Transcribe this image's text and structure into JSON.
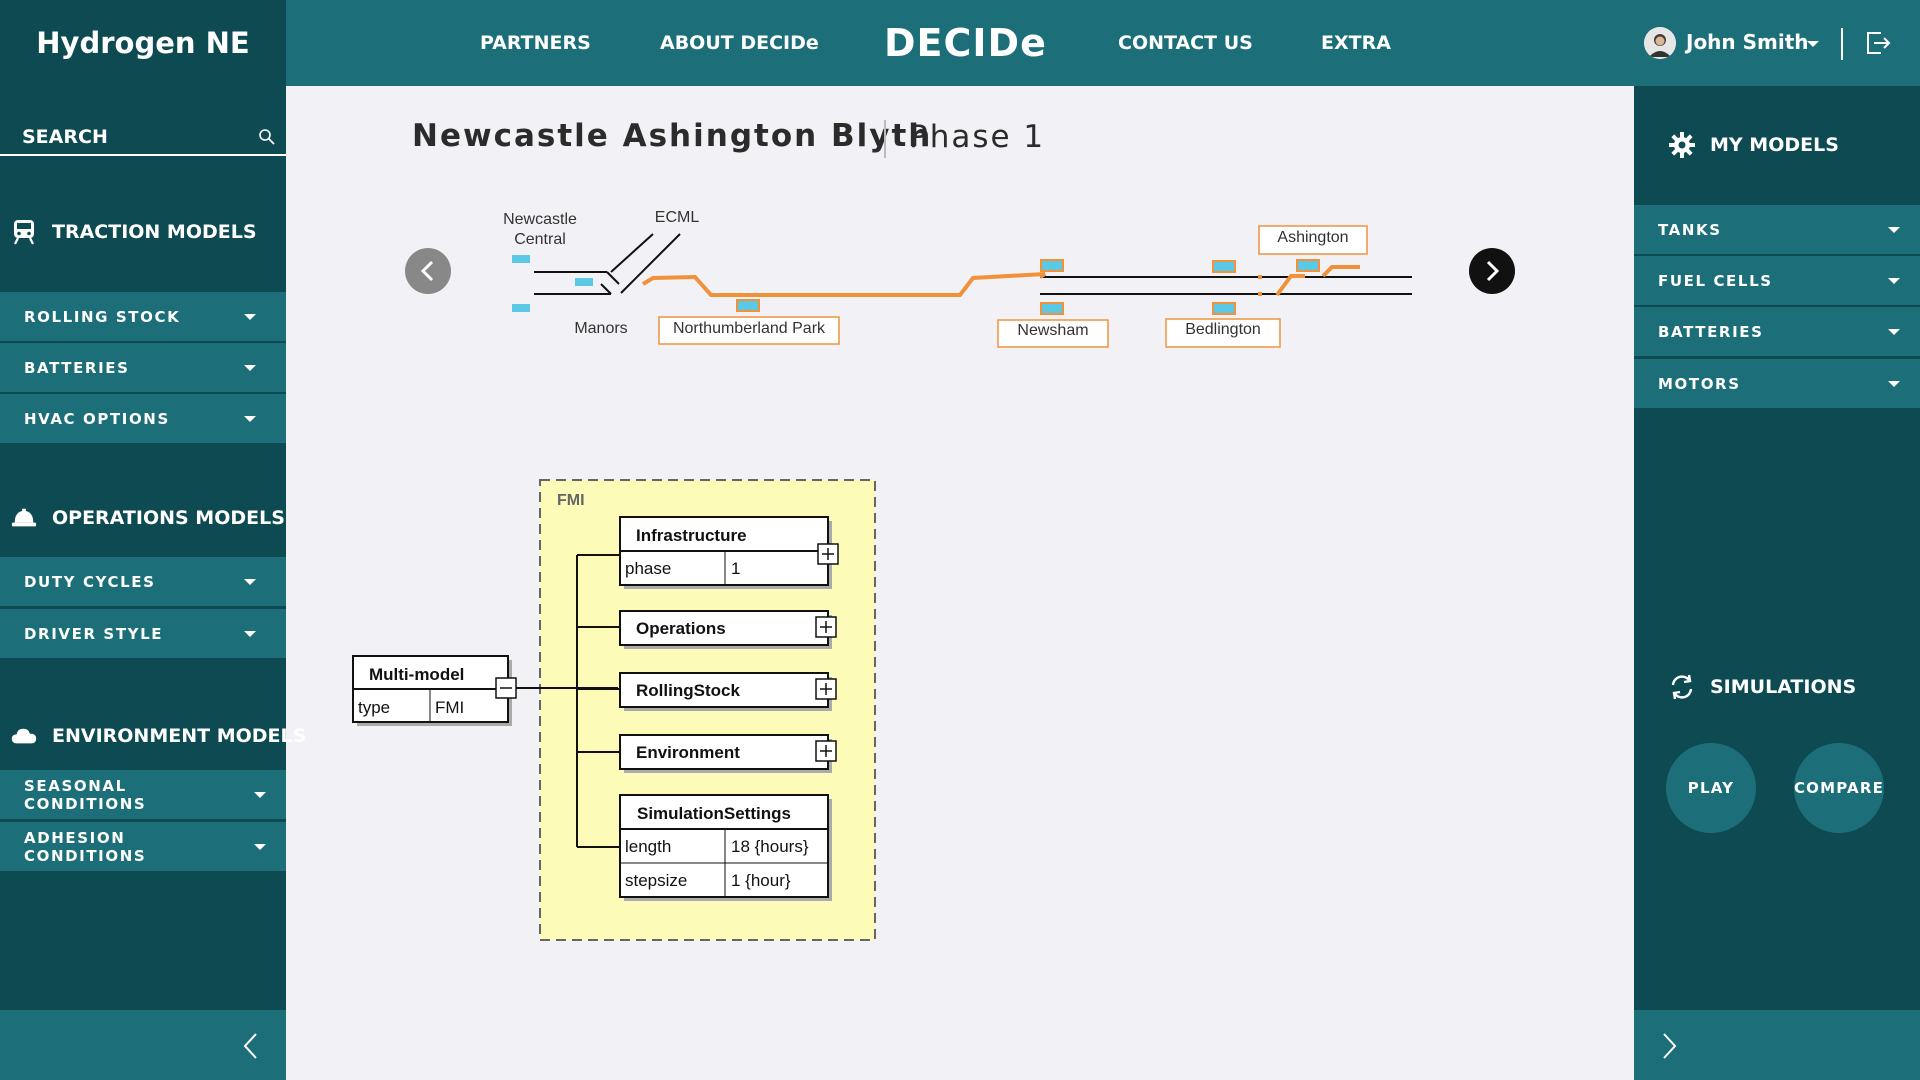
{
  "brand": "Hydrogen NE",
  "search": {
    "placeholder": "SEARCH"
  },
  "left_sidebar": {
    "sections": [
      {
        "title": "TRACTION MODELS",
        "icon": "train-icon",
        "items": [
          {
            "label": "ROLLING STOCK"
          },
          {
            "label": "BATTERIES"
          },
          {
            "label": "HVAC OPTIONS"
          }
        ]
      },
      {
        "title": "OPERATIONS MODELS",
        "icon": "hard-hat-icon",
        "items": [
          {
            "label": "DUTY CYCLES"
          },
          {
            "label": "DRIVER STYLE"
          }
        ]
      },
      {
        "title": "ENVIRONMENT MODELS",
        "icon": "cloud-icon",
        "items": [
          {
            "label": "SEASONAL CONDITIONS"
          },
          {
            "label": "ADHESION CONDITIONS"
          }
        ]
      }
    ]
  },
  "topnav": {
    "links": [
      {
        "label": "PARTNERS"
      },
      {
        "label": "ABOUT DECIDe"
      },
      {
        "label": "CONTACT US"
      },
      {
        "label": "EXTRA"
      }
    ],
    "logo": "DECIDe"
  },
  "user": {
    "name": "John Smith"
  },
  "right_sidebar": {
    "my_models": {
      "title": "MY MODELS",
      "items": [
        {
          "label": "TANKS"
        },
        {
          "label": "FUEL CELLS"
        },
        {
          "label": "BATTERIES"
        },
        {
          "label": "MOTORS"
        }
      ]
    },
    "simulations": {
      "title": "SIMULATIONS",
      "play": "PLAY",
      "compare": "COMPARE"
    }
  },
  "main": {
    "title": "Newcastle Ashington Blyth",
    "subtitle": "Phase 1",
    "route_map": {
      "labels": {
        "newcastle_1": "Newcastle",
        "newcastle_2": "Central",
        "ecml": "ECML",
        "manors": "Manors",
        "northumberland_park": "Northumberland Park",
        "newsham": "Newsham",
        "bedlington": "Bedlington",
        "ashington": "Ashington"
      }
    },
    "diagram": {
      "container_label": "FMI",
      "multi_model": {
        "title": "Multi-model",
        "key": "type",
        "value": "FMI"
      },
      "infrastructure": {
        "title": "Infrastructure",
        "rows": [
          {
            "key": "phase",
            "value": "1"
          }
        ]
      },
      "operations": {
        "title": "Operations"
      },
      "rolling_stock": {
        "title": "RollingStock"
      },
      "environment": {
        "title": "Environment"
      },
      "simulation_settings": {
        "title": "SimulationSettings",
        "rows": [
          {
            "key": "length",
            "value": "18 {hours}"
          },
          {
            "key": "stepsize",
            "value": "1 {hour}"
          }
        ]
      }
    }
  },
  "colors": {
    "sidebar_dark": "#0d4a52",
    "sidebar_teal": "#1c6f78",
    "route_orange": "#f0923a",
    "station_blue": "#5bc8e6",
    "fmi_yellow": "#fdfbb8"
  }
}
